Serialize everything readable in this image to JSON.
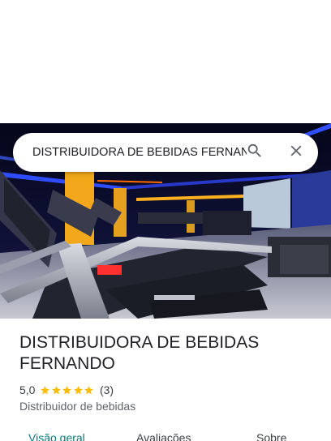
{
  "search": {
    "query": "DISTRIBUIDORA DE BEBIDAS FERNANDO"
  },
  "place": {
    "name": "DISTRIBUIDORA DE BEBIDAS FERNANDO",
    "rating": "5,0",
    "stars": 5,
    "review_count": "(3)",
    "category": "Distribuidor de bebidas"
  },
  "tabs": [
    {
      "label": "Visão geral",
      "active": true
    },
    {
      "label": "Avaliações",
      "active": false
    },
    {
      "label": "Sobre",
      "active": false
    }
  ],
  "colors": {
    "star": "#fbbc04",
    "active_tab": "#0b7a7a",
    "icon": "#5f6368"
  }
}
